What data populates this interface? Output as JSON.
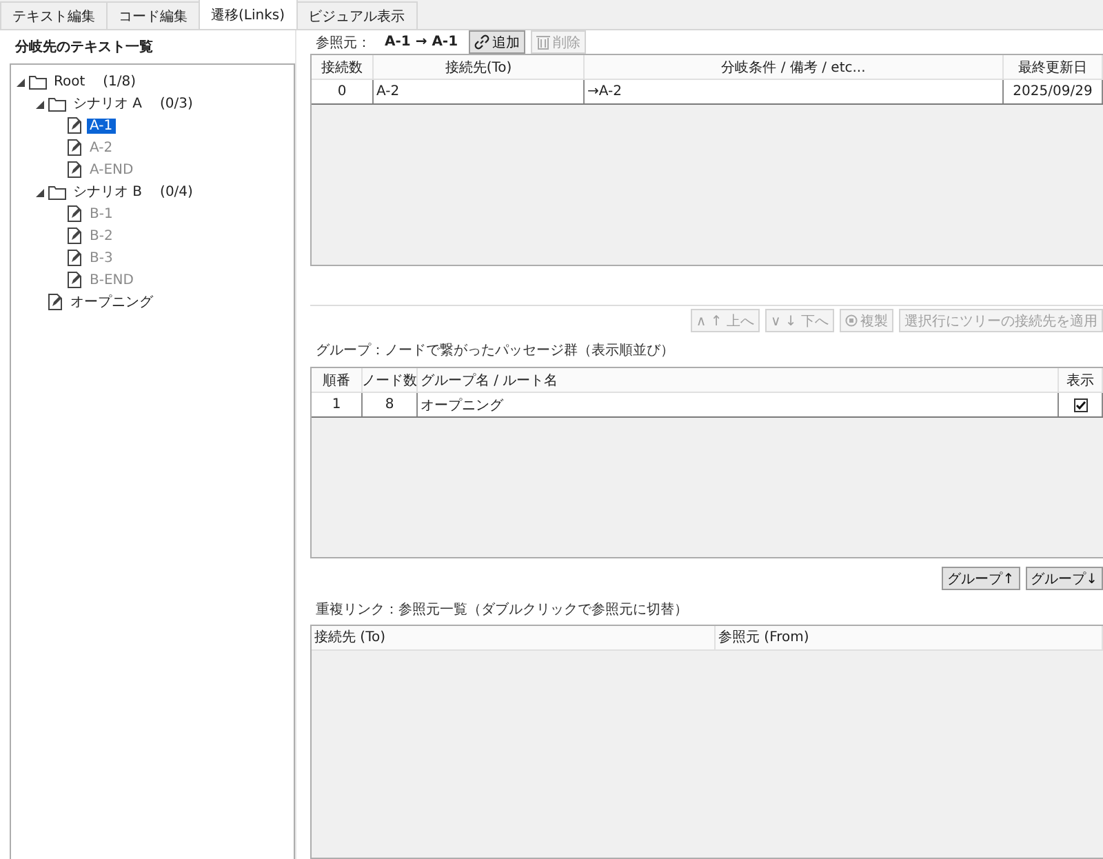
{
  "tabs": [
    {
      "label": "テキスト編集",
      "selected": false
    },
    {
      "label": "コード編集",
      "selected": false
    },
    {
      "label": "遷移(Links)",
      "selected": true
    },
    {
      "label": "ビジュアル表示",
      "selected": false
    }
  ],
  "sidebar": {
    "title": "分岐先のテキスト一覧",
    "tree": [
      {
        "kind": "folder",
        "label": "Root",
        "count": "(1/8)",
        "expanded": true,
        "children": [
          {
            "kind": "folder",
            "label": "シナリオ A",
            "count": "(0/3)",
            "expanded": true,
            "children": [
              {
                "kind": "page",
                "label": "A-1",
                "selected": true,
                "greyed": false
              },
              {
                "kind": "page",
                "label": "A-2",
                "selected": false,
                "greyed": true
              },
              {
                "kind": "page",
                "label": "A-END",
                "selected": false,
                "greyed": true
              }
            ]
          },
          {
            "kind": "folder",
            "label": "シナリオ B",
            "count": "(0/4)",
            "expanded": true,
            "children": [
              {
                "kind": "page",
                "label": "B-1",
                "selected": false,
                "greyed": true
              },
              {
                "kind": "page",
                "label": "B-2",
                "selected": false,
                "greyed": true
              },
              {
                "kind": "page",
                "label": "B-3",
                "selected": false,
                "greyed": true
              },
              {
                "kind": "page",
                "label": "B-END",
                "selected": false,
                "greyed": true
              }
            ]
          },
          {
            "kind": "page",
            "label": "オープニング",
            "selected": false,
            "greyed": false
          }
        ]
      }
    ]
  },
  "source": {
    "label": "参照元：",
    "value": "A-1 → A-1"
  },
  "toolbar": [
    {
      "kind": "link",
      "label": "追加",
      "disabled": false
    },
    {
      "kind": "trash",
      "label": "削除",
      "disabled": true
    }
  ],
  "links_table": {
    "columns": [
      "接続数",
      "接続先(To)",
      "分岐条件 / 備考 / etc...",
      "最終更新日"
    ],
    "rows": [
      [
        "0",
        "A-2",
        "→A-2",
        "2025/09/29"
      ]
    ]
  },
  "row_buttons": [
    {
      "kind": "text",
      "label": "∧ ↑ 上へ",
      "disabled": true
    },
    {
      "kind": "text",
      "label": "∨ ↓ 下へ",
      "disabled": true
    },
    {
      "kind": "copy",
      "label": "複製",
      "disabled": true
    },
    {
      "kind": "text",
      "label": "選択行にツリーの接続先を適用",
      "disabled": true
    }
  ],
  "groups_caption": "グループ：ノードで繋がったパッセージ群（表示順並び）",
  "groups_table": {
    "columns": [
      "順番",
      "ノード数",
      "グループ名 / ルート名",
      "表示"
    ],
    "rows": [
      {
        "order": "1",
        "nodes": "8",
        "name": "オープニング",
        "visible": true
      }
    ]
  },
  "group_buttons": [
    {
      "label": "グループ↑",
      "disabled": false
    },
    {
      "label": "グループ↓",
      "disabled": false
    }
  ],
  "duplicates_caption": "重複リンク：参照元一覧（ダブルクリックで参照元に切替）",
  "duplicates_table": {
    "columns": [
      "接続先 (To)",
      "参照元 (From)"
    ]
  }
}
